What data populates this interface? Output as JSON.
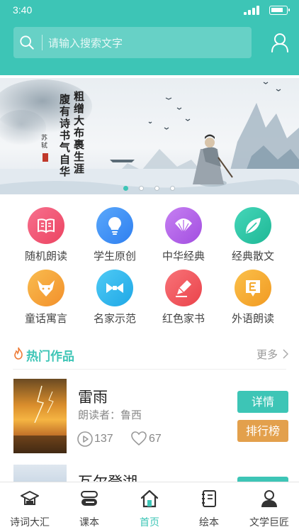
{
  "status_bar": {
    "time": "3:40"
  },
  "search": {
    "placeholder": "请输入搜索文字"
  },
  "banner": {
    "calligraphy_lines": [
      "粗缯大布裹生涯",
      "腹有诗书气自华"
    ],
    "seal_text": "苏轼",
    "slide_count": 4,
    "active_slide": 0
  },
  "categories": [
    {
      "label": "随机朗读",
      "icon": "book-icon",
      "color": "#f0506e"
    },
    {
      "label": "学生原创",
      "icon": "lightbulb-icon",
      "color": "#3d8ff5"
    },
    {
      "label": "中华经典",
      "icon": "fan-icon",
      "color": "#b05ee8"
    },
    {
      "label": "经典散文",
      "icon": "leaf-icon",
      "color": "#2bc7a8"
    },
    {
      "label": "童话寓言",
      "icon": "fox-icon",
      "color": "#f5a23a"
    },
    {
      "label": "名家示范",
      "icon": "bowtie-icon",
      "color": "#29b8ee"
    },
    {
      "label": "红色家书",
      "icon": "pen-icon",
      "color": "#f2545b"
    },
    {
      "label": "外语朗读",
      "icon": "letter-e-icon",
      "color": "#f5ac34"
    }
  ],
  "hot_works": {
    "title": "热门作品",
    "more": "更多",
    "items": [
      {
        "title": "雷雨",
        "reader": "朗读者：鲁西",
        "plays": "137",
        "likes": "67",
        "detail_btn": "详情",
        "rank_btn": "排行榜"
      },
      {
        "title": "瓦尔登湖"
      }
    ]
  },
  "tabs": [
    {
      "label": "诗词大汇",
      "icon": "graduation-cap-icon"
    },
    {
      "label": "课本",
      "icon": "textbook-icon"
    },
    {
      "label": "首页",
      "icon": "home-icon",
      "active": true
    },
    {
      "label": "绘本",
      "icon": "notebook-icon"
    },
    {
      "label": "文学巨匠",
      "icon": "person-icon"
    }
  ],
  "colors": {
    "accent": "#3dc5b6",
    "rank_button": "#e3a04c"
  }
}
